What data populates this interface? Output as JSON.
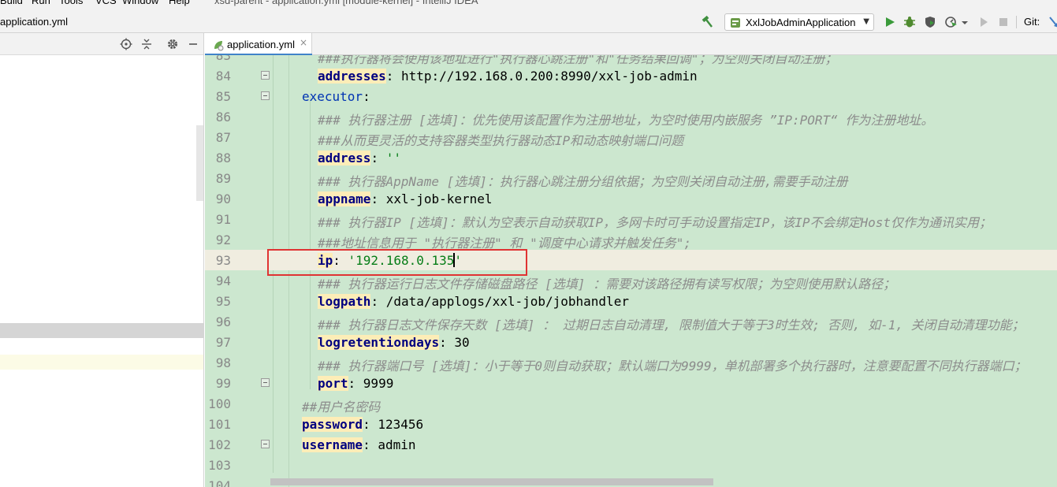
{
  "menubar": {
    "items": [
      "Build",
      "Run",
      "Tools",
      "VCS",
      "Window",
      "Help"
    ],
    "window_title": "xsd-parent - application.yml [module-kernel] - IntelliJ IDEA"
  },
  "navbar": {
    "breadcrumb": "application.yml",
    "run_config": "XxlJobAdminApplication",
    "git_label": "Git:"
  },
  "tabs": [
    {
      "label": "application.yml",
      "close": "×"
    }
  ],
  "colors": {
    "editor_bg": "#cce7cf",
    "current_line": "#f0ede0",
    "key_highlight": "#fdedb7",
    "annotation_box": "#e03333",
    "tab_underline": "#4083c9"
  },
  "editor": {
    "current_line_number": "93",
    "lines": [
      {
        "num": "83",
        "indent": 3,
        "parts": [
          {
            "t": "###执行器将会使用该地址进行\"执行器心跳注册\"和\"任务结果回调\"；为空则关闭自动注册；",
            "c": "c"
          }
        ]
      },
      {
        "num": "84",
        "indent": 3,
        "fold": true,
        "parts": [
          {
            "t": "addresses",
            "c": "k"
          },
          {
            "t": ": http://192.168.0.200:8990/xxl-job-admin"
          }
        ]
      },
      {
        "num": "85",
        "indent": 2,
        "fold": true,
        "parts": [
          {
            "t": "executor",
            "c": "kb"
          },
          {
            "t": ":"
          }
        ]
      },
      {
        "num": "86",
        "indent": 3,
        "parts": [
          {
            "t": "### 执行器注册 [选填]：优先使用该配置作为注册地址，为空时使用内嵌服务 ”IP:PORT“ 作为注册地址。",
            "c": "c"
          }
        ]
      },
      {
        "num": "87",
        "indent": 3,
        "parts": [
          {
            "t": "###从而更灵活的支持容器类型执行器动态IP和动态映射端口问题",
            "c": "c"
          }
        ]
      },
      {
        "num": "88",
        "indent": 3,
        "parts": [
          {
            "t": "address",
            "c": "k"
          },
          {
            "t": ": "
          },
          {
            "t": "''",
            "c": "s"
          }
        ]
      },
      {
        "num": "89",
        "indent": 3,
        "parts": [
          {
            "t": "### 执行器AppName [选填]：执行器心跳注册分组依据；为空则关闭自动注册,需要手动注册",
            "c": "c"
          }
        ]
      },
      {
        "num": "90",
        "indent": 3,
        "parts": [
          {
            "t": "appname",
            "c": "k"
          },
          {
            "t": ": xxl-job-kernel"
          }
        ]
      },
      {
        "num": "91",
        "indent": 3,
        "parts": [
          {
            "t": "### 执行器IP [选填]：默认为空表示自动获取IP，多网卡时可手动设置指定IP，该IP不会绑定Host仅作为通讯实用；",
            "c": "c"
          }
        ]
      },
      {
        "num": "92",
        "indent": 3,
        "parts": [
          {
            "t": "###地址信息用于 \"执行器注册\" 和 \"调度中心请求并触发任务\";",
            "c": "c"
          }
        ]
      },
      {
        "num": "93",
        "indent": 3,
        "parts": [
          {
            "t": "ip",
            "c": "k"
          },
          {
            "t": ": "
          },
          {
            "t": "'192.168.0.135",
            "c": "s"
          },
          {
            "cursor": true
          },
          {
            "t": "'",
            "c": "s"
          }
        ]
      },
      {
        "num": "94",
        "indent": 3,
        "parts": [
          {
            "t": "### 执行器运行日志文件存储磁盘路径 [选填] ：需要对该路径拥有读写权限；为空则使用默认路径；",
            "c": "c"
          }
        ]
      },
      {
        "num": "95",
        "indent": 3,
        "parts": [
          {
            "t": "logpath",
            "c": "k"
          },
          {
            "t": ": /data/applogs/xxl-job/jobhandler"
          }
        ]
      },
      {
        "num": "96",
        "indent": 3,
        "parts": [
          {
            "t": "### 执行器日志文件保存天数 [选填] ： 过期日志自动清理, 限制值大于等于3时生效; 否则, 如-1, 关闭自动清理功能；",
            "c": "c"
          }
        ]
      },
      {
        "num": "97",
        "indent": 3,
        "parts": [
          {
            "t": "logretentiondays",
            "c": "k"
          },
          {
            "t": ": 30"
          }
        ]
      },
      {
        "num": "98",
        "indent": 3,
        "parts": [
          {
            "t": "### 执行器端口号 [选填]：小于等于0则自动获取；默认端口为9999，单机部署多个执行器时，注意要配置不同执行器端口；",
            "c": "c"
          }
        ]
      },
      {
        "num": "99",
        "indent": 3,
        "fold": true,
        "parts": [
          {
            "t": "port",
            "c": "k"
          },
          {
            "t": ": 9999"
          }
        ]
      },
      {
        "num": "100",
        "indent": 2,
        "parts": [
          {
            "t": "##用户名密码",
            "c": "c"
          }
        ]
      },
      {
        "num": "101",
        "indent": 2,
        "parts": [
          {
            "t": "password",
            "c": "k"
          },
          {
            "t": ": 123456"
          }
        ]
      },
      {
        "num": "102",
        "indent": 2,
        "fold": true,
        "parts": [
          {
            "t": "username",
            "c": "k"
          },
          {
            "t": ": admin"
          }
        ]
      },
      {
        "num": "103",
        "indent": 0,
        "parts": []
      },
      {
        "num": "104",
        "indent": 0,
        "parts": []
      }
    ]
  }
}
